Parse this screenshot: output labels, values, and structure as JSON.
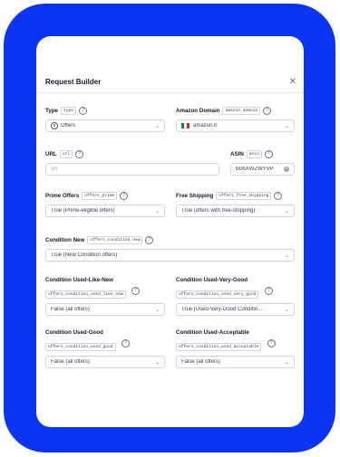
{
  "dialog": {
    "title": "Request Builder",
    "close_icon": "close-icon"
  },
  "type_field": {
    "label": "Type",
    "tag": "type",
    "value": "Offers"
  },
  "amazon_domain": {
    "label": "Amazon Domain",
    "tag": "amazon_domain",
    "value": "amazon.it"
  },
  "url_field": {
    "label": "URL",
    "tag": "url",
    "placeholder": "url"
  },
  "asin_field": {
    "label": "ASIN",
    "tag": "asin",
    "value": "B06XWZWYVP"
  },
  "prime_offers": {
    "label": "Prime Offers",
    "tag": "offers_prime",
    "value": "True (Prime-eligible offers)"
  },
  "free_shipping": {
    "label": "Free Shipping",
    "tag": "offers_free_shipping",
    "value": "True (offers with free-shipping)"
  },
  "condition_new": {
    "label": "Condition New",
    "tag": "offers_condition_new",
    "value": "True (New Condition offers)"
  },
  "used_like_new": {
    "label": "Condition Used-Like-New",
    "tag": "offers_condition_used_like_new",
    "value": "False (all offers)"
  },
  "used_very_good": {
    "label": "Condition Used-Very-Good",
    "tag": "offers_condition_used_very_good",
    "value": "True (Used-Very-Good Conditio..."
  },
  "used_good": {
    "label": "Condition Used-Good",
    "tag": "offers_condition_used_good",
    "value": "False (all offers)"
  },
  "used_acceptable": {
    "label": "Condition Used-Acceptable",
    "tag": "offers_condition_used_acceptable",
    "value": "False (all offers)"
  },
  "colors": {
    "frame": "#0b35f0",
    "flag_green": "#009246",
    "flag_white": "#ffffff",
    "flag_red": "#ce2b37"
  }
}
